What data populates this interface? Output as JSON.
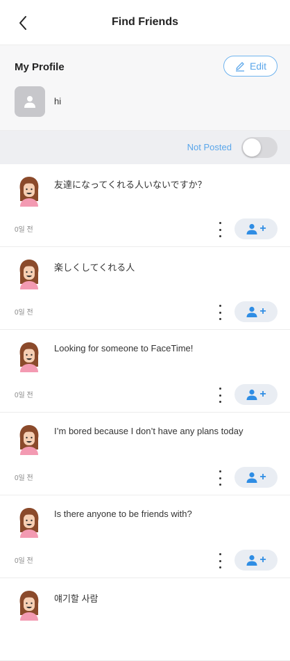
{
  "header": {
    "title": "Find Friends"
  },
  "profile": {
    "title": "My Profile",
    "edit_label": "Edit",
    "text": "hi"
  },
  "toggle": {
    "label": "Not Posted",
    "on": false
  },
  "posts": [
    {
      "message": "友達になってくれる人いないですか？",
      "time": "0일 전"
    },
    {
      "message": "楽しくしてくれる人",
      "time": "0일 전"
    },
    {
      "message": "Looking for someone to FaceTime!",
      "time": "0일 전"
    },
    {
      "message": "I’m bored because I don’t have any plans today",
      "time": "0일 전"
    },
    {
      "message": "Is there anyone to be friends with?",
      "time": "0일 전"
    },
    {
      "message": "얘기할 사람",
      "time": ""
    }
  ],
  "colors": {
    "accent": "#2f8de4",
    "edit_border": "#6fb3ee"
  }
}
